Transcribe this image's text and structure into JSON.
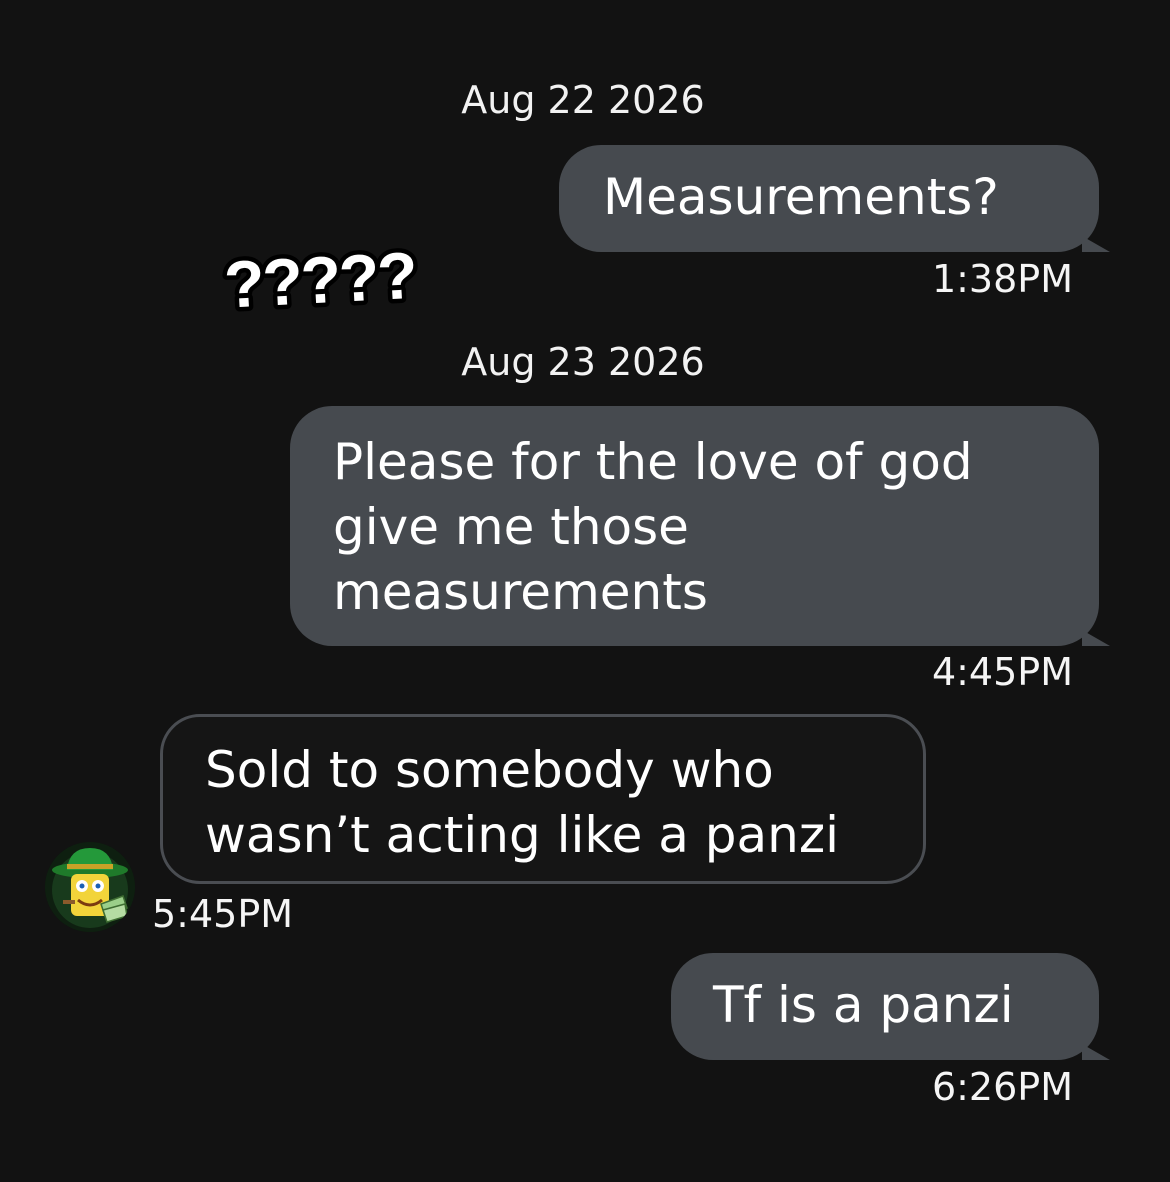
{
  "thread": {
    "date_1": "Aug 22 2026",
    "date_2": "Aug 23 2026",
    "messages": [
      {
        "direction": "sent",
        "text": "Measurements?",
        "time": "1:38PM"
      },
      {
        "direction": "sent",
        "text": "Please for the love of god\ngive me those\nmeasurements",
        "time": "4:45PM"
      },
      {
        "direction": "received",
        "text": "Sold to somebody who\nwasn’t acting like a panzi",
        "time": "5:45PM"
      },
      {
        "direction": "sent",
        "text": "Tf is a panzi",
        "time": "6:26PM"
      }
    ]
  },
  "overlay": {
    "sticker_text": "?????"
  },
  "avatar": {
    "icon": "cartoon-avatar-green-hat"
  },
  "colors": {
    "background": "#121212",
    "sent_bubble": "#464a4f",
    "received_bubble_border": "#4a4d52",
    "text": "#ffffff"
  }
}
